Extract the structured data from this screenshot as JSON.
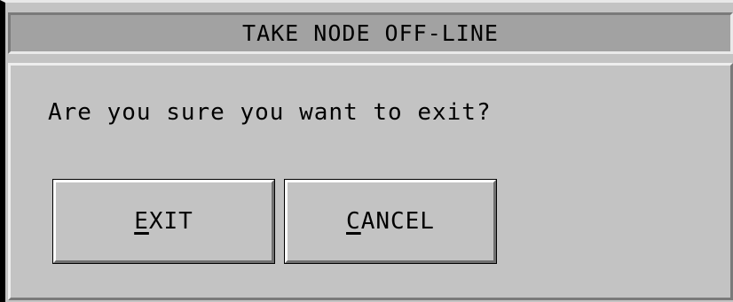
{
  "dialog": {
    "title": "TAKE NODE OFF-LINE",
    "message": "Are you sure you want to exit?"
  },
  "buttons": {
    "exit": {
      "mnemonic": "E",
      "rest": "XIT"
    },
    "cancel": {
      "mnemonic": "C",
      "rest": "ANCEL"
    }
  },
  "colors": {
    "dialog_background": "#c3c3c3",
    "titlebar_background": "#a2a2a2",
    "text": "#000000"
  }
}
